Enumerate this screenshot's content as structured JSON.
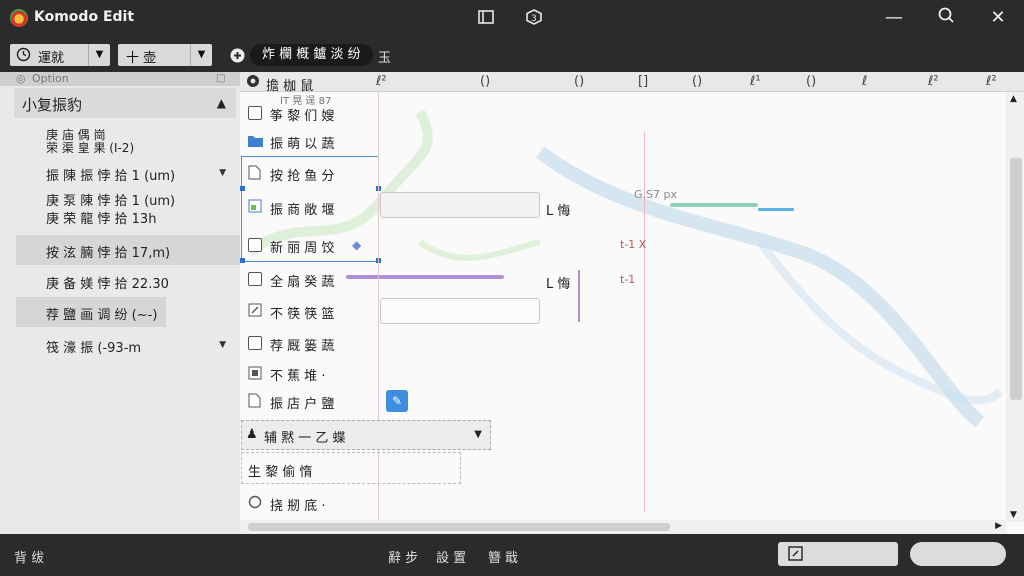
{
  "window": {
    "title": "Komodo Edit",
    "icons": [
      "panel-icon",
      "package-icon"
    ],
    "controls": {
      "minimize": "—",
      "maximize": "□",
      "close": "✕"
    }
  },
  "toolbar": {
    "combo1_label": "運就",
    "combo2_label": "十 壶",
    "pill_label": "炸 欄 槪 鑪 淡 纷",
    "extra_label": "玉"
  },
  "sidebar": {
    "header": "Option",
    "group_title": "小复振豹",
    "items": [
      {
        "label": "庚 庙 偶 崗\n荣 渠 皇 果 (I-2)"
      },
      {
        "label": "振 陳 振 悖 拾 1 (um)"
      },
      {
        "label": "庚 泵 陳 悖 拾 1 (um)\n庚 荣 龍 悖 拾 13h"
      },
      {
        "label": "按 泫 腩 悖 拾 17,m)"
      },
      {
        "label": "庚 备 媄 悖 拾 22.30"
      },
      {
        "label": "荐 鹽 画 调 纷 (~-)"
      },
      {
        "label": "筏 濠 振 (-93-m"
      }
    ]
  },
  "main": {
    "column_header": "擔 枷 鼠",
    "column_marks": [
      "ℓ²",
      "()",
      "()",
      "[]",
      "()",
      "ℓ¹",
      "()",
      "ℓ",
      "ℓ²",
      "ℓ²"
    ],
    "tree": [
      {
        "label": "筝 黎 们 嫂"
      },
      {
        "label": "振 萌 以 蔬"
      },
      {
        "label": "按 抢 鱼 分"
      },
      {
        "label": "振 商 敞 堰"
      },
      {
        "label": "新 丽 周 饺"
      },
      {
        "label": "全 扇 癸 蔬"
      },
      {
        "label": "不 筷 筷 篮"
      },
      {
        "label": "荐 厩 篓 蔬"
      },
      {
        "label": "不 蕉 堆 ·"
      },
      {
        "label": "振 店 户 鹽"
      }
    ],
    "combo_label": "辅 黙 一 乙 蝶",
    "field2_label": "生 黎 偷 惰",
    "last_item": "挠 剏 底 ·",
    "annotations": [
      "G.S7 px",
      "t-1 X",
      "t-1",
      "L 悔",
      "L 悔"
    ],
    "top_note": "IT 晃 逞 87"
  },
  "statusbar": {
    "left": "背 绂",
    "mid": [
      "辭 步",
      "設 置",
      "簪 戢"
    ]
  },
  "colors": {
    "accent": "#3d8ee0",
    "selection": "#4a8fd8",
    "bar_purple": "#b48fd8",
    "bar_teal": "#8cd4b8",
    "bar_blue": "#5ab0e0",
    "annot_red": "#d45a5a"
  }
}
